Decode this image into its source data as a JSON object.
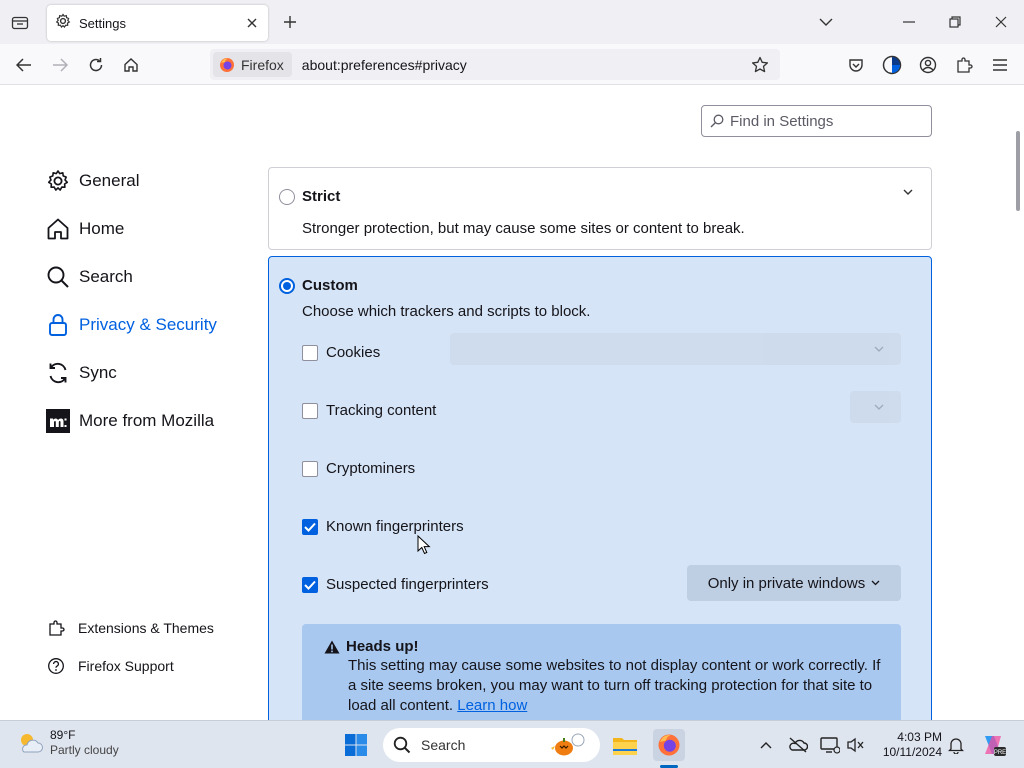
{
  "browser": {
    "tab_title": "Settings",
    "identity_label": "Firefox",
    "url": "about:preferences#privacy"
  },
  "settings": {
    "find_placeholder": "Find in Settings",
    "nav": {
      "general": "General",
      "home": "Home",
      "search": "Search",
      "privacy": "Privacy & Security",
      "sync": "Sync",
      "more": "More from Mozilla",
      "extensions": "Extensions & Themes",
      "support": "Firefox Support"
    },
    "strict": {
      "title": "Strict",
      "description": "Stronger protection, but may cause some sites or content to break."
    },
    "custom": {
      "title": "Custom",
      "description": "Choose which trackers and scripts to block.",
      "options": {
        "cookies": "Cookies",
        "tracking": "Tracking content",
        "cryptominers": "Cryptominers",
        "known_fp": "Known fingerprinters",
        "suspected_fp": "Suspected fingerprinters"
      },
      "suspected_fp_select": "Only in private windows",
      "warning_title": "Heads up!",
      "warning_text": "This setting may cause some websites to not display content or work correctly. If a site seems broken, you may want to turn off tracking protection for that site to load all content.",
      "learn_how": "Learn how"
    }
  },
  "taskbar": {
    "temperature": "89°F",
    "condition": "Partly cloudy",
    "search_label": "Search",
    "time": "4:03 PM",
    "date": "10/11/2024"
  },
  "colors": {
    "accent": "#0061e0",
    "custom_bg": "#d5e4f6",
    "warning_bg": "#a8c8f0"
  }
}
